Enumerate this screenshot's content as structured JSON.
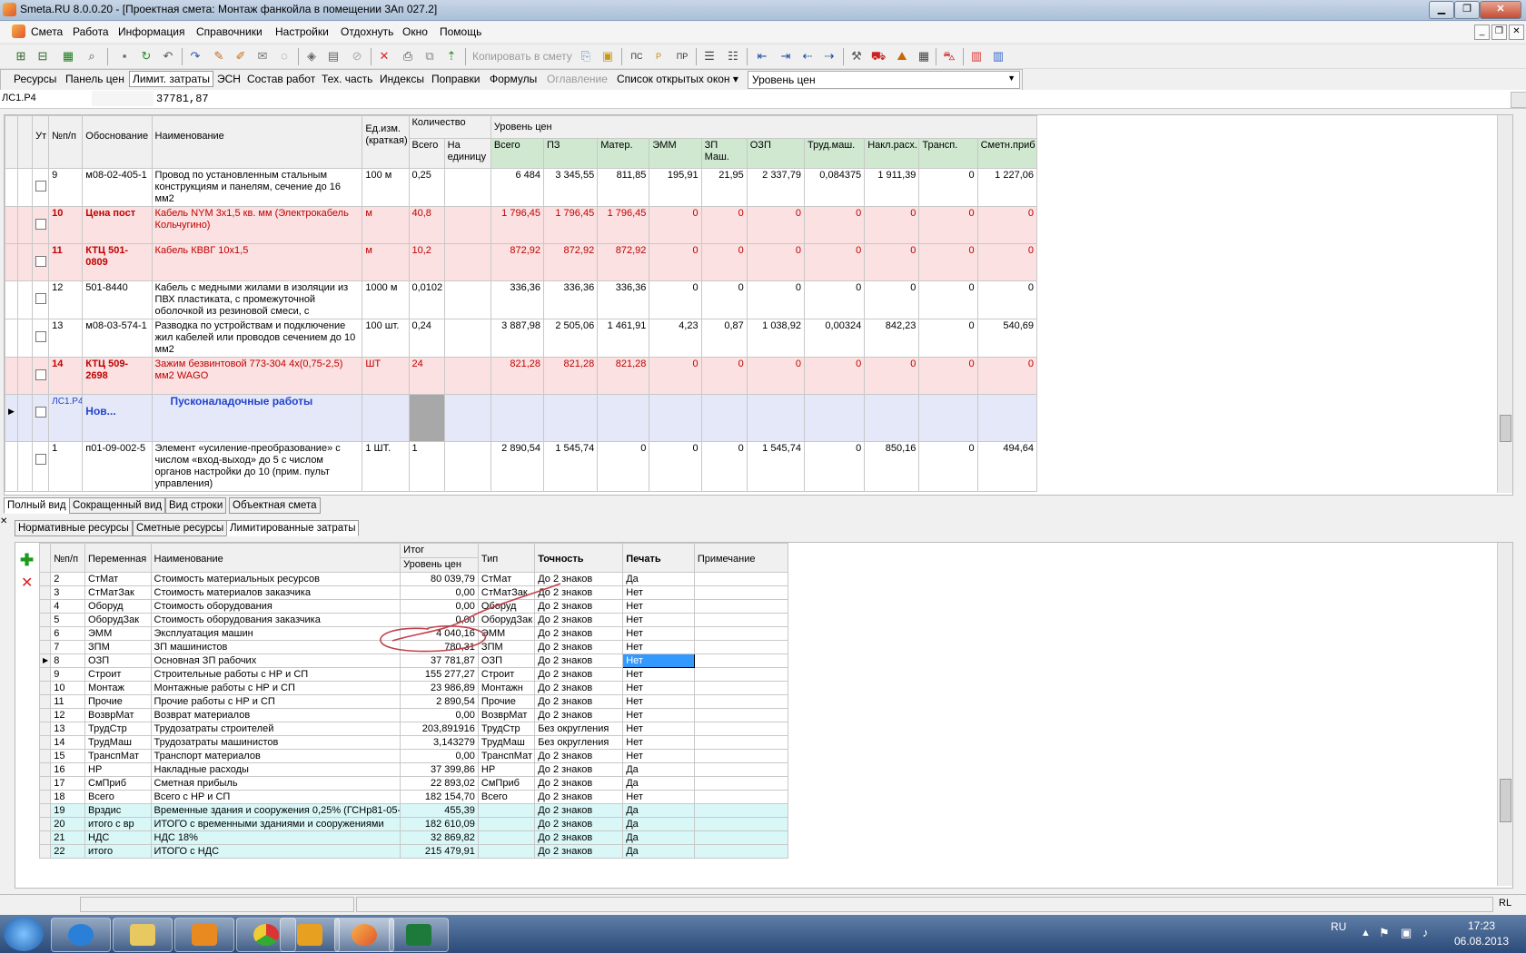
{
  "window": {
    "app": "Smeta.RU  8.0.0.20",
    "title": "- [Проектная смета: Монтаж фанкойла в помещении 3Ап 027.2]"
  },
  "menu": [
    "Смета",
    "Работа",
    "Информация",
    "Справочники",
    "Настройки",
    "Отдохнуть",
    "Окно",
    "Помощь"
  ],
  "toolbar": {
    "copy_label": "Копировать в смету"
  },
  "tabs": [
    {
      "label": "Ресурсы",
      "state": "normal"
    },
    {
      "label": "Панель цен",
      "state": "normal"
    },
    {
      "label": "Лимит. затраты",
      "state": "active"
    },
    {
      "label": "ЭСН",
      "state": "normal"
    },
    {
      "label": "Состав работ",
      "state": "normal"
    },
    {
      "label": "Тех. часть",
      "state": "normal"
    },
    {
      "label": "Индексы",
      "state": "normal"
    },
    {
      "label": "Поправки",
      "state": "normal"
    },
    {
      "label": "Формулы",
      "state": "normal"
    },
    {
      "label": "Оглавление",
      "state": "disabled"
    },
    {
      "label": "Список открытых окон ▾",
      "state": "normal"
    }
  ],
  "price_level_select": "Уровень цен",
  "formula_bar": {
    "cell": "ЛС1.Р4",
    "value": "37781,87"
  },
  "upper_grid": {
    "headers": {
      "ut": "Ут",
      "num": "№п/п",
      "basis": "Обоснование",
      "name": "Наименование",
      "unit": "Ед.изм. (краткая)",
      "qty_group": "Количество",
      "qty_total": "Всего",
      "qty_per": "На единицу",
      "level_group": "Уровень цен",
      "cols": [
        "Всего",
        "ПЗ",
        "Матер.",
        "ЭММ",
        "ЗП Маш.",
        "ОЗП",
        "Труд.маш.",
        "Накл.расх.",
        "Трансп.",
        "Сметн.приб"
      ]
    },
    "rows": [
      {
        "type": "normal",
        "num": "9",
        "basis": "м08-02-405-1",
        "name": "Провод по установленным стальным конструкциям и панелям, сечение до 16 мм2",
        "unit": "100 м",
        "qty": "0,25",
        "per": "",
        "v": [
          "6 484",
          "3 345,55",
          "811,85",
          "195,91",
          "21,95",
          "2 337,79",
          "0,084375",
          "1 911,39",
          "0",
          "1 227,06"
        ]
      },
      {
        "type": "red",
        "num": "10",
        "basis": "Цена пост",
        "name": "Кабель NYM 3х1,5 кв. мм (Электрокабель Кольчугино)",
        "unit": "м",
        "qty": "40,8",
        "per": "",
        "v": [
          "1 796,45",
          "1 796,45",
          "1 796,45",
          "0",
          "0",
          "0",
          "0",
          "0",
          "0",
          "0"
        ]
      },
      {
        "type": "red",
        "num": "11",
        "basis": "КТЦ 501-0809",
        "name": "Кабель  КВВГ 10х1,5",
        "unit": "м",
        "qty": "10,2",
        "per": "",
        "v": [
          "872,92",
          "872,92",
          "872,92",
          "0",
          "0",
          "0",
          "0",
          "0",
          "0",
          "0"
        ]
      },
      {
        "type": "normal",
        "num": "12",
        "basis": "501-8440",
        "name": "Кабель с медными жилами в изоляции из ПВХ пластиката, с промежуточной оболочкой из резиновой смеси, с",
        "unit": "1000 м",
        "qty": "0,0102",
        "per": "",
        "v": [
          "336,36",
          "336,36",
          "336,36",
          "0",
          "0",
          "0",
          "0",
          "0",
          "0",
          "0"
        ]
      },
      {
        "type": "normal",
        "num": "13",
        "basis": "м08-03-574-1",
        "name": "Разводка по устройствам и подключение жил кабелей или проводов сечением до 10 мм2",
        "unit": "100 шт.",
        "qty": "0,24",
        "per": "",
        "v": [
          "3 887,98",
          "2 505,06",
          "1 461,91",
          "4,23",
          "0,87",
          "1 038,92",
          "0,00324",
          "842,23",
          "0",
          "540,69"
        ]
      },
      {
        "type": "red",
        "num": "14",
        "basis": "КТЦ 509-2698",
        "name": "Зажим безвинтовой 773-304 4х(0,75-2,5) мм2 WAGO",
        "unit": "ШТ",
        "qty": "24",
        "per": "",
        "v": [
          "821,28",
          "821,28",
          "821,28",
          "0",
          "0",
          "0",
          "0",
          "0",
          "0",
          "0"
        ]
      },
      {
        "type": "section",
        "num": "ЛС1.Р4",
        "basis": "Нов...",
        "name": "Пусконаладочные работы",
        "unit": "",
        "qty": "",
        "per": "",
        "v": [
          "",
          "",
          "",
          "",
          "",
          "",
          "",
          "",
          "",
          ""
        ]
      },
      {
        "type": "normal",
        "num": "1",
        "basis": "п01-09-002-5",
        "name": "Элемент «усиление-преобразование» с числом «вход-выход» до 5 с числом органов настройки до 10 (прим. пульт управления)",
        "unit": "1 ШТ.",
        "qty": "1",
        "per": "",
        "v": [
          "2 890,54",
          "1 545,74",
          "0",
          "0",
          "0",
          "1 545,74",
          "0",
          "850,16",
          "0",
          "494,64"
        ]
      }
    ]
  },
  "view_tabs": [
    "Полный вид",
    "Сокращенный вид",
    "Вид строки",
    "Объектная смета"
  ],
  "lower_tabs": [
    "Нормативные ресурсы",
    "Сметные ресурсы",
    "Лимитированные затраты"
  ],
  "lower_grid": {
    "headers": {
      "num": "№п/п",
      "var": "Переменная",
      "name": "Наименование",
      "itog": "Итог",
      "level": "Уровень цен",
      "type": "Тип",
      "prec": "Точность",
      "print": "Печать",
      "note": "Примечание"
    },
    "rows": [
      {
        "num": "2",
        "var": "СтМат",
        "name": "Стоимость материальных ресурсов",
        "val": "80 039,79",
        "type": "СтМат",
        "prec": "До 2 знаков",
        "print": "Да",
        "cyan": false
      },
      {
        "num": "3",
        "var": "СтМатЗак",
        "name": "Стоимость материалов заказчика",
        "val": "0,00",
        "type": "СтМатЗак",
        "prec": "До 2 знаков",
        "print": "Нет",
        "cyan": false
      },
      {
        "num": "4",
        "var": "Оборуд",
        "name": "Стоимость оборудования",
        "val": "0,00",
        "type": "Оборуд",
        "prec": "До 2 знаков",
        "print": "Нет",
        "cyan": false
      },
      {
        "num": "5",
        "var": "ОборудЗак",
        "name": "Стоимость оборудования заказчика",
        "val": "0,00",
        "type": "ОборудЗак",
        "prec": "До 2 знаков",
        "print": "Нет",
        "cyan": false
      },
      {
        "num": "6",
        "var": "ЭММ",
        "name": "Эксплуатация машин",
        "val": "4 040,16",
        "type": "ЭММ",
        "prec": "До 2 знаков",
        "print": "Нет",
        "cyan": false
      },
      {
        "num": "7",
        "var": "ЗПМ",
        "name": "ЗП машинистов",
        "val": "780,31",
        "type": "ЗПМ",
        "prec": "До 2 знаков",
        "print": "Нет",
        "cyan": false
      },
      {
        "num": "8",
        "var": "ОЗП",
        "name": "Основная ЗП рабочих",
        "val": "37 781,87",
        "type": "ОЗП",
        "prec": "До 2 знаков",
        "print": "Нет",
        "cyan": false,
        "selected": true
      },
      {
        "num": "9",
        "var": "Строит",
        "name": "Строительные работы с НР и СП",
        "val": "155 277,27",
        "type": "Строит",
        "prec": "До 2 знаков",
        "print": "Нет",
        "cyan": false
      },
      {
        "num": "10",
        "var": "Монтаж",
        "name": "Монтажные работы с НР и СП",
        "val": "23 986,89",
        "type": "Монтажн",
        "prec": "До 2 знаков",
        "print": "Нет",
        "cyan": false
      },
      {
        "num": "11",
        "var": "Прочие",
        "name": "Прочие работы с НР и СП",
        "val": "2 890,54",
        "type": "Прочие",
        "prec": "До 2 знаков",
        "print": "Нет",
        "cyan": false
      },
      {
        "num": "12",
        "var": "ВозврМат",
        "name": "Возврат материалов",
        "val": "0,00",
        "type": "ВозврМат",
        "prec": "До 2 знаков",
        "print": "Нет",
        "cyan": false
      },
      {
        "num": "13",
        "var": "ТрудСтр",
        "name": "Трудозатраты строителей",
        "val": "203,891916",
        "type": "ТрудСтр",
        "prec": "Без округления",
        "print": "Нет",
        "cyan": false
      },
      {
        "num": "14",
        "var": "ТрудМаш",
        "name": "Трудозатраты машинистов",
        "val": "3,143279",
        "type": "ТрудМаш",
        "prec": "Без округления",
        "print": "Нет",
        "cyan": false
      },
      {
        "num": "15",
        "var": "ТранспМат",
        "name": "Транспорт материалов",
        "val": "0,00",
        "type": "ТранспМат",
        "prec": "До 2 знаков",
        "print": "Нет",
        "cyan": false
      },
      {
        "num": "16",
        "var": "НР",
        "name": "Накладные расходы",
        "val": "37 399,86",
        "type": "НР",
        "prec": "До 2 знаков",
        "print": "Да",
        "cyan": false
      },
      {
        "num": "17",
        "var": "СмПриб",
        "name": "Сметная прибыль",
        "val": "22 893,02",
        "type": "СмПриб",
        "prec": "До 2 знаков",
        "print": "Да",
        "cyan": false
      },
      {
        "num": "18",
        "var": "Всего",
        "name": "Всего с НР и СП",
        "val": "182 154,70",
        "type": "Всего",
        "prec": "До 2 знаков",
        "print": "Нет",
        "cyan": false
      },
      {
        "num": "19",
        "var": "Врздис",
        "name": "Временные здания и сооружения 0,25% (ГСНр81-05-(",
        "val": "455,39",
        "type": "",
        "prec": "До 2 знаков",
        "print": "Да",
        "cyan": true
      },
      {
        "num": "20",
        "var": "итого с вр",
        "name": "ИТОГО с временными зданиями и сооружениями",
        "val": "182 610,09",
        "type": "",
        "prec": "До 2 знаков",
        "print": "Да",
        "cyan": true
      },
      {
        "num": "21",
        "var": "НДС",
        "name": "НДС 18%",
        "val": "32 869,82",
        "type": "",
        "prec": "До 2 знаков",
        "print": "Да",
        "cyan": true
      },
      {
        "num": "22",
        "var": "итого",
        "name": "ИТОГО с НДС",
        "val": "215 479,91",
        "type": "",
        "prec": "До 2 знаков",
        "print": "Да",
        "cyan": true
      }
    ]
  },
  "status": {
    "right": "RL"
  },
  "tray": {
    "lang": "RU",
    "time": "17:23",
    "date": "06.08.2013"
  },
  "colors": {
    "red_row": "#fbe1e1",
    "red_text": "#c00000",
    "section_row": "#e5e8f8",
    "cyan_row": "#d9f7f7",
    "green_header": "#cfe8cf",
    "selection": "#3399ff"
  }
}
